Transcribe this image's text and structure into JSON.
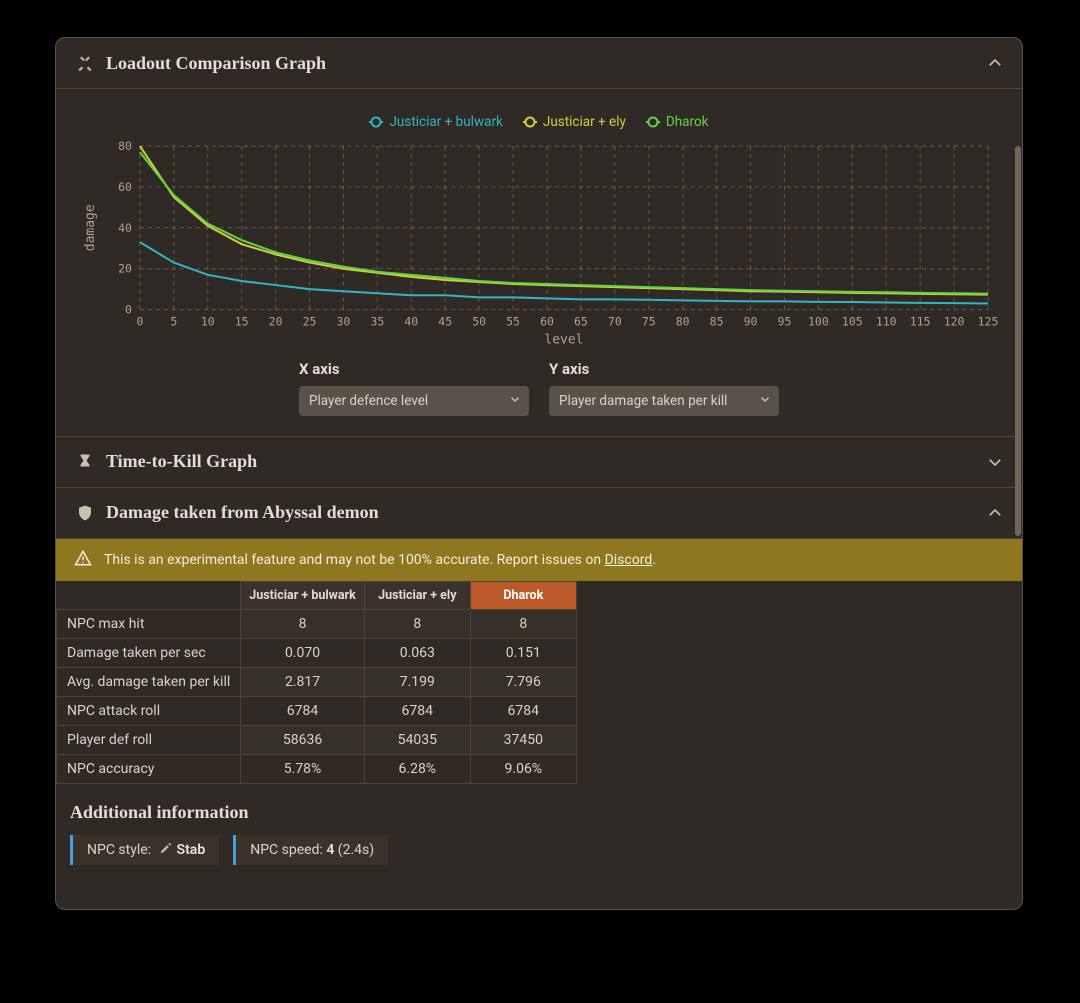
{
  "panels": {
    "comparison": {
      "title": "Loadout Comparison Graph",
      "expanded": true
    },
    "ttk": {
      "title": "Time-to-Kill Graph",
      "expanded": false
    },
    "damage": {
      "title": "Damage taken from Abyssal demon",
      "expanded": true
    }
  },
  "chart_data": {
    "type": "line",
    "title": "",
    "xlabel": "level",
    "ylabel": "damage",
    "xlim": [
      0,
      125
    ],
    "ylim": [
      0,
      80
    ],
    "xticks": [
      0,
      5,
      10,
      15,
      20,
      25,
      30,
      35,
      40,
      45,
      50,
      55,
      60,
      65,
      70,
      75,
      80,
      85,
      90,
      95,
      100,
      105,
      110,
      115,
      120,
      125
    ],
    "yticks": [
      0,
      20,
      40,
      60,
      80
    ],
    "x": [
      0,
      5,
      10,
      15,
      20,
      25,
      30,
      35,
      40,
      45,
      50,
      55,
      60,
      65,
      70,
      75,
      80,
      85,
      90,
      95,
      100,
      105,
      110,
      115,
      120,
      125
    ],
    "series": [
      {
        "name": "Justiciar + bulwark",
        "color": "#2fb6c2",
        "values": [
          33,
          23,
          17,
          14,
          12,
          10,
          9,
          8,
          7,
          7,
          6,
          6,
          5.5,
          5,
          5,
          4.8,
          4.5,
          4.3,
          4,
          4,
          3.8,
          3.7,
          3.5,
          3.3,
          3.2,
          3
        ]
      },
      {
        "name": "Justiciar + ely",
        "color": "#d4cc3a",
        "values": [
          80,
          55,
          41,
          32,
          27,
          23,
          20,
          18,
          16,
          14.5,
          13.5,
          12.5,
          12,
          11.5,
          11,
          10.5,
          10,
          9.5,
          9,
          8.8,
          8.5,
          8.2,
          8,
          7.7,
          7.5,
          7.3
        ]
      },
      {
        "name": "Dharok",
        "color": "#5fd447",
        "values": [
          77,
          56,
          42,
          34,
          28,
          24,
          21,
          18.5,
          17,
          15.5,
          14,
          13,
          12.5,
          12,
          11.5,
          11,
          10.5,
          10,
          9.5,
          9.2,
          9,
          8.7,
          8.5,
          8.2,
          8,
          7.8
        ]
      }
    ]
  },
  "axis_controls": {
    "x_label": "X axis",
    "x_value": "Player defence level",
    "y_label": "Y axis",
    "y_value": "Player damage taken per kill"
  },
  "warning": {
    "text_prefix": "This is an experimental feature and may not be 100% accurate. Report issues on ",
    "link_text": "Discord",
    "text_suffix": "."
  },
  "damage_table": {
    "columns": [
      "Justiciar + bulwark",
      "Justiciar + ely",
      "Dharok"
    ],
    "highlight_col": 2,
    "rows": [
      {
        "label": "NPC max hit",
        "values": [
          "8",
          "8",
          "8"
        ],
        "best_all": true
      },
      {
        "label": "Damage taken per sec",
        "values": [
          "0.070",
          "0.063",
          "0.151"
        ]
      },
      {
        "label": "Avg. damage taken per kill",
        "values": [
          "2.817",
          "7.199",
          "7.796"
        ],
        "best": 0
      },
      {
        "label": "NPC attack roll",
        "values": [
          "6784",
          "6784",
          "6784"
        ],
        "best_all": true
      },
      {
        "label": "Player def roll",
        "values": [
          "58636",
          "54035",
          "37450"
        ],
        "best": 0
      },
      {
        "label": "NPC accuracy",
        "values": [
          "5.78%",
          "6.28%",
          "9.06%"
        ],
        "best": 0
      }
    ]
  },
  "additional": {
    "heading": "Additional information",
    "npc_style_label": "NPC style:",
    "npc_style_value": "Stab",
    "npc_speed_label": "NPC speed:",
    "npc_speed_value": "4",
    "npc_speed_seconds": "(2.4s)"
  }
}
